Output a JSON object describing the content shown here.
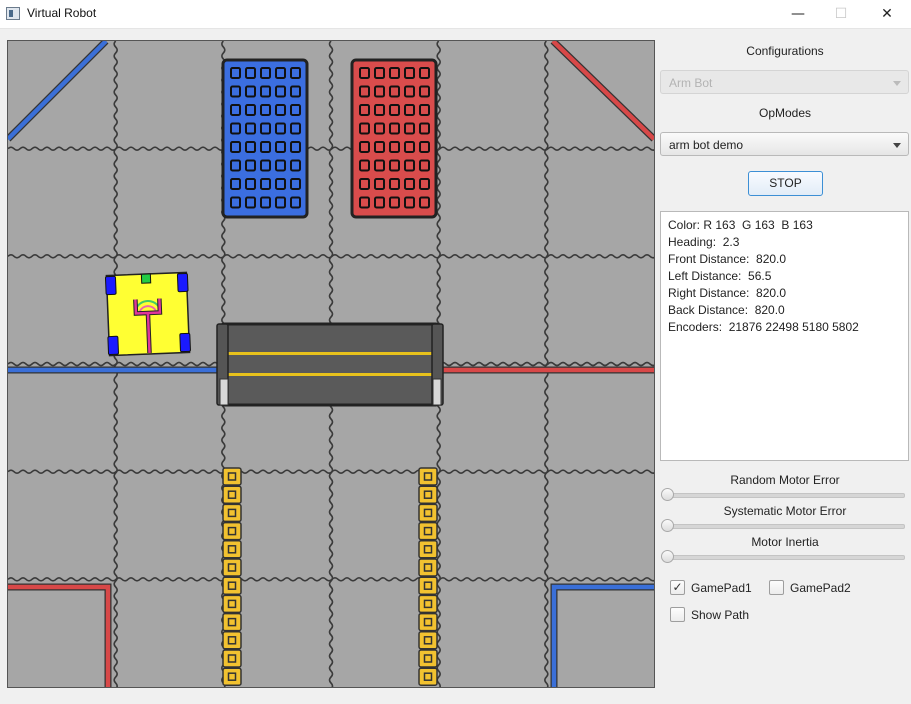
{
  "window": {
    "title": "Virtual Robot",
    "minimize_glyph": "—",
    "maximize_glyph": "☐",
    "close_glyph": "✕"
  },
  "panel": {
    "configurations_label": "Configurations",
    "configuration_value": "Arm Bot",
    "opmodes_label": "OpModes",
    "opmode_value": "arm bot demo",
    "stop_label": "STOP",
    "telemetry": [
      "Color: R 163  G 163  B 163",
      "Heading:  2.3",
      "Front Distance:  820.0",
      "Left Distance:  56.5",
      "Right Distance:  820.0",
      "Back Distance:  820.0",
      "Encoders:  21876 22498 5180 5802"
    ],
    "sliders": [
      {
        "label": "Random Motor Error",
        "value": 0
      },
      {
        "label": "Systematic Motor Error",
        "value": 0
      },
      {
        "label": "Motor Inertia",
        "value": 0
      }
    ],
    "gamepad1_label": "GamePad1",
    "gamepad1_checked": true,
    "gamepad2_label": "GamePad2",
    "gamepad2_checked": false,
    "show_path_label": "Show Path",
    "show_path_checked": false
  },
  "colors": {
    "field_gray": "#a6a6a6",
    "tile_seam": "#3a3a3a",
    "tape_blue": "#3a6fd8",
    "tape_red": "#d84848",
    "blue_goal": "#3b6ee0",
    "red_goal": "#d94c4c",
    "ring_stack": "#f2c230",
    "bridge": "#5a5a5a",
    "bridge_stripe": "#e8c21c",
    "robot_body": "#ffff33",
    "robot_wheel": "#1a1aff",
    "robot_arm": "#e0359a",
    "robot_sensor": "#22cc44",
    "checkbox_blue": "#3c8fd5"
  }
}
